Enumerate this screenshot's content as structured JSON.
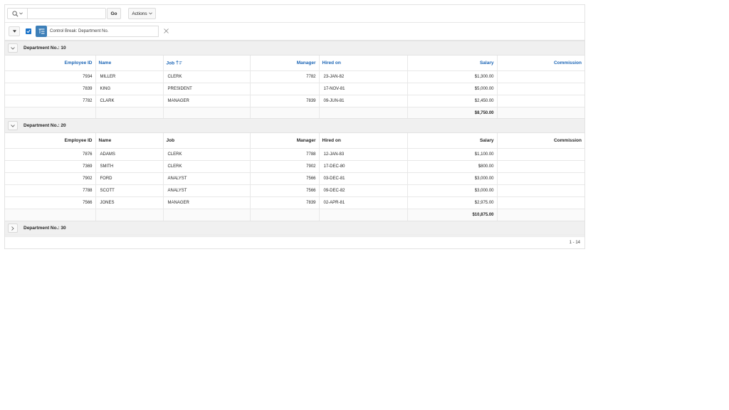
{
  "toolbar": {
    "search_value": "",
    "go_label": "Go",
    "actions_label": "Actions"
  },
  "filter": {
    "label": "Control Break: Department No."
  },
  "groups": [
    {
      "label": "Department No.: 10",
      "expanded": true,
      "linked_headers": true,
      "columns": [
        "Employee ID",
        "Name",
        "Job",
        "Manager",
        "Hired on",
        "Salary",
        "Commission"
      ],
      "rows": [
        {
          "id": "7934",
          "name": "MILLER",
          "job": "CLERK",
          "manager": "7782",
          "hired": "23-JAN-82",
          "salary": "$1,300.00",
          "commission": ""
        },
        {
          "id": "7839",
          "name": "KING",
          "job": "PRESIDENT",
          "manager": "",
          "hired": "17-NOV-81",
          "salary": "$5,000.00",
          "commission": ""
        },
        {
          "id": "7782",
          "name": "CLARK",
          "job": "MANAGER",
          "manager": "7839",
          "hired": "09-JUN-81",
          "salary": "$2,450.00",
          "commission": ""
        }
      ],
      "total_salary": "$8,750.00"
    },
    {
      "label": "Department No.: 20",
      "expanded": true,
      "linked_headers": false,
      "columns": [
        "Employee ID",
        "Name",
        "Job",
        "Manager",
        "Hired on",
        "Salary",
        "Commission"
      ],
      "rows": [
        {
          "id": "7876",
          "name": "ADAMS",
          "job": "CLERK",
          "manager": "7788",
          "hired": "12-JAN-83",
          "salary": "$1,100.00",
          "commission": ""
        },
        {
          "id": "7369",
          "name": "SMITH",
          "job": "CLERK",
          "manager": "7902",
          "hired": "17-DEC-80",
          "salary": "$800.00",
          "commission": ""
        },
        {
          "id": "7902",
          "name": "FORD",
          "job": "ANALYST",
          "manager": "7566",
          "hired": "03-DEC-81",
          "salary": "$3,000.00",
          "commission": ""
        },
        {
          "id": "7788",
          "name": "SCOTT",
          "job": "ANALYST",
          "manager": "7566",
          "hired": "09-DEC-82",
          "salary": "$3,000.00",
          "commission": ""
        },
        {
          "id": "7566",
          "name": "JONES",
          "job": "MANAGER",
          "manager": "7839",
          "hired": "02-APR-81",
          "salary": "$2,975.00",
          "commission": ""
        }
      ],
      "total_salary": "$10,875.00"
    },
    {
      "label": "Department No.: 30",
      "expanded": false
    }
  ],
  "pagination": "1 - 14",
  "colors": {
    "link": "#1a64b5",
    "accent": "#3d7fb8",
    "checkbox": "#1a73c9"
  }
}
